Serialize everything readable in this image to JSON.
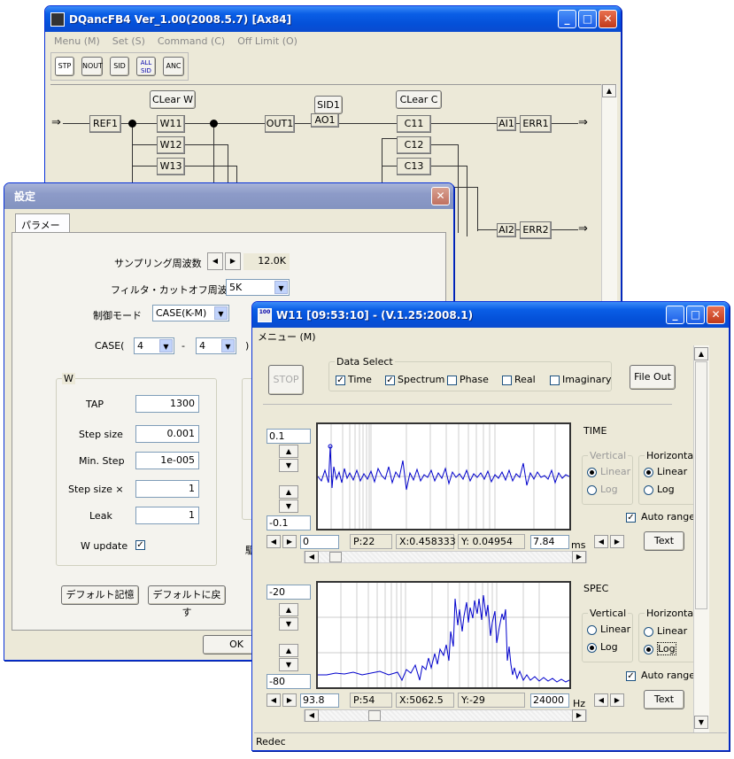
{
  "main_window": {
    "title": "DQancFB4  Ver_1.00(2008.5.7) [Ax84]",
    "menu": [
      "Menu (M)",
      "Set (S)",
      "Command (C)",
      "Off Limit (O)"
    ],
    "toolbar": [
      "STP",
      "NOUT",
      "SID",
      "ALL SID",
      "ANC"
    ],
    "diagram": {
      "clear_w": "CLear W",
      "clear_c": "CLear C",
      "sid1": "SID1",
      "ao1": "AO1",
      "ref1": "REF1",
      "w_nodes": [
        "W11",
        "W12",
        "W13"
      ],
      "out1": "OUT1",
      "c_nodes": [
        "C11",
        "C12",
        "C13"
      ],
      "ai1": "AI1",
      "err1": "ERR1",
      "ai2": "AI2",
      "err2": "ERR2",
      "arrow": "⇒"
    }
  },
  "settings": {
    "title": "設定",
    "tab": "パラメータ",
    "sampling_label": "サンプリング周波数",
    "sampling_value": "12.0K",
    "filter_label": "フィルタ・カットオフ周波数",
    "filter_value": "5K",
    "mode_label": "制御モード",
    "mode_value": "CASE(K-M)",
    "case_label": "CASE(",
    "case_from": "4",
    "case_dash": "-",
    "case_to": "4",
    "case_close": ")",
    "group_w": "W",
    "tap_label": "TAP",
    "tap_value": "1300",
    "step_label": "Step size",
    "step_value": "0.001",
    "minstep_label": "Min. Step",
    "minstep_value": "1e-005",
    "stepx_label": "Step size ×",
    "stepx_value": "1",
    "leak_label": "Leak",
    "leak_value": "1",
    "wupdate_label": "W update",
    "btn_remember": "デフォルト記憶",
    "btn_restore": "デフォルトに戻す",
    "ok": "OK",
    "partial_label": "駆"
  },
  "w11": {
    "title": "W11 [09:53:10] - (V.1.25:2008.1)",
    "menu": "メニュー (M)",
    "stop": "STOP",
    "data_select": "Data Select",
    "options": [
      {
        "label": "Time",
        "checked": true
      },
      {
        "label": "Spectrum",
        "checked": true
      },
      {
        "label": "Phase",
        "checked": false
      },
      {
        "label": "Real",
        "checked": false
      },
      {
        "label": "Imaginary",
        "checked": false
      }
    ],
    "file_out": "File Out",
    "time": {
      "name": "TIME",
      "ymax": "0.1",
      "ymin": "-0.1",
      "x_start": "0",
      "p": "P:22",
      "x": "X:0.458333",
      "y": "Y: 0.04954",
      "x_end": "7.84",
      "unit": "ms",
      "vertical": "Vertical",
      "horizontal": "Horizontal",
      "v_linear": "Linear",
      "v_log": "Log",
      "h_linear": "Linear",
      "h_log": "Log",
      "auto_range": "Auto range",
      "text": "Text"
    },
    "spec": {
      "name": "SPEC",
      "ymax": "-20",
      "ymin": "-80",
      "x_start": "93.8",
      "p": "P:54",
      "x": "X:5062.5",
      "y": "Y:-29",
      "x_end": "24000",
      "unit": "Hz",
      "vertical": "Vertical",
      "horizontal": "Horizontal",
      "v_linear": "Linear",
      "v_log": "Log",
      "h_linear": "Linear",
      "h_log": "Log",
      "auto_range": "Auto range",
      "text": "Text"
    },
    "status": "Redec"
  }
}
